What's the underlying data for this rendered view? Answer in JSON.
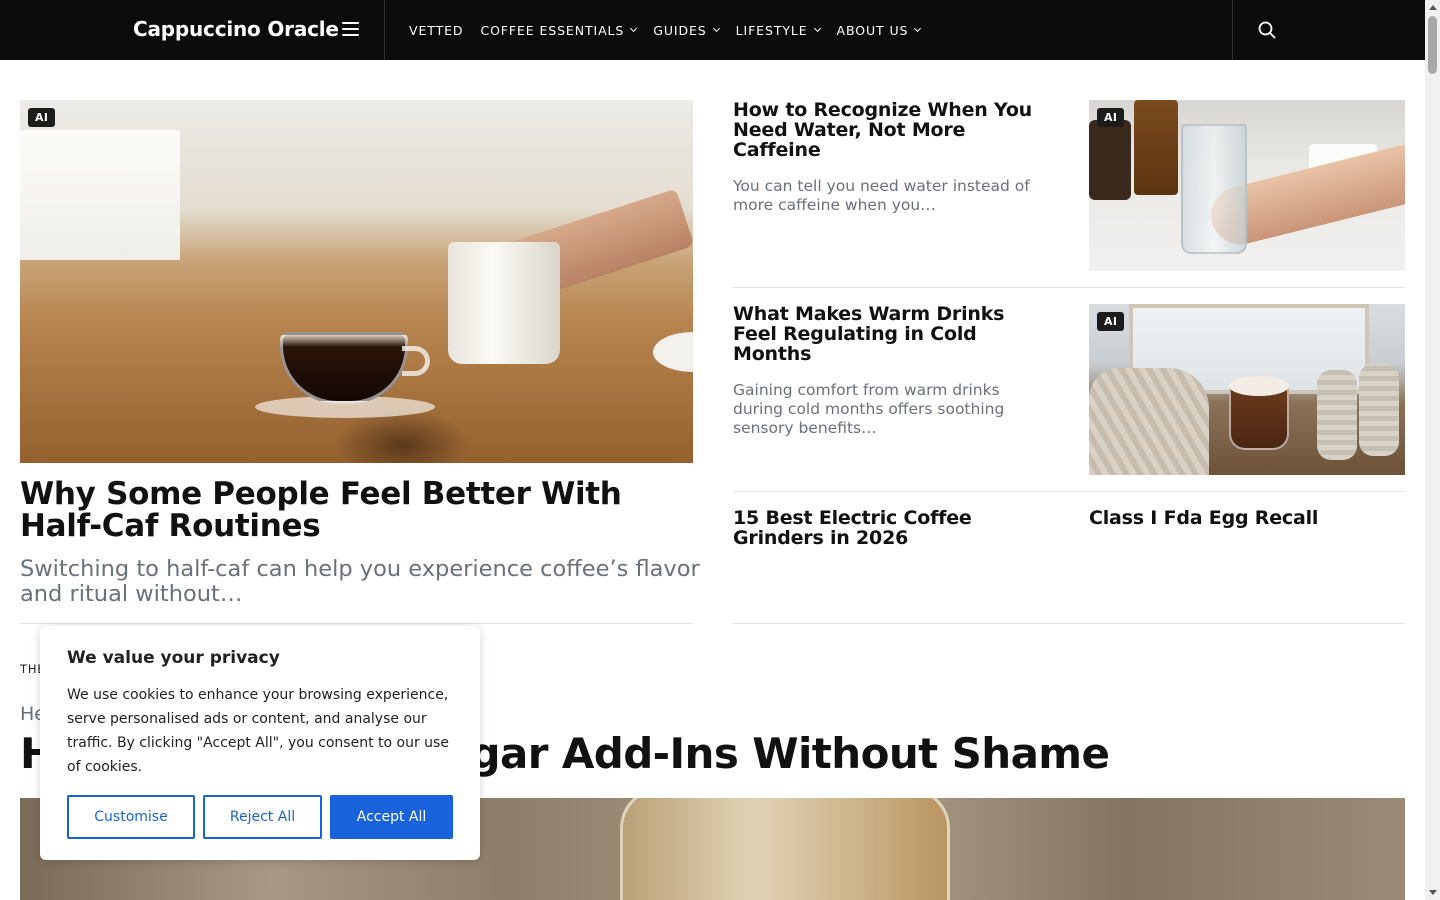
{
  "header": {
    "brand": "Cappuccino Oracle",
    "nav": [
      {
        "label": "VETTED",
        "has_dropdown": false
      },
      {
        "label": "COFFEE ESSENTIALS",
        "has_dropdown": true
      },
      {
        "label": "GUIDES",
        "has_dropdown": true
      },
      {
        "label": "LIFESTYLE",
        "has_dropdown": true
      },
      {
        "label": "ABOUT US",
        "has_dropdown": true
      }
    ],
    "menu_icon": "hamburger-icon",
    "search_icon": "search-icon",
    "background": "#0b0b0b"
  },
  "featured": {
    "badge": "AI",
    "title": "Why Some People Feel Better With Half-Caf Routines",
    "excerpt": "Switching to half-caf can help you experience coffee’s flavor and ritual without…"
  },
  "side_articles": [
    {
      "title": "How to Recognize When You Need Water, Not More Caffeine",
      "excerpt": "You can tell you need water instead of more caffeine when you…",
      "badge": "AI"
    },
    {
      "title": "What Makes Warm Drinks Feel Regulating in Cold Months",
      "excerpt": "Gaining comfort from warm drinks during cold months offers soothing sensory benefits…",
      "badge": "AI"
    },
    {
      "title": "15 Best Electric Coffee Grinders in 2026"
    },
    {
      "title": "Class I Fda Egg Recall"
    }
  ],
  "section": {
    "label": "THE",
    "kicker": "He",
    "title": "How to Embrace Sugar Add-Ins Without Shame"
  },
  "cookie_banner": {
    "title": "We value your privacy",
    "text": "We use cookies to enhance your browsing experience, serve personalised ads or content, and analyse our traffic. By clicking \"Accept All\", you consent to our use of cookies.",
    "customise": "Customise",
    "reject": "Reject All",
    "accept": "Accept All",
    "accent_color": "#1863dc"
  }
}
